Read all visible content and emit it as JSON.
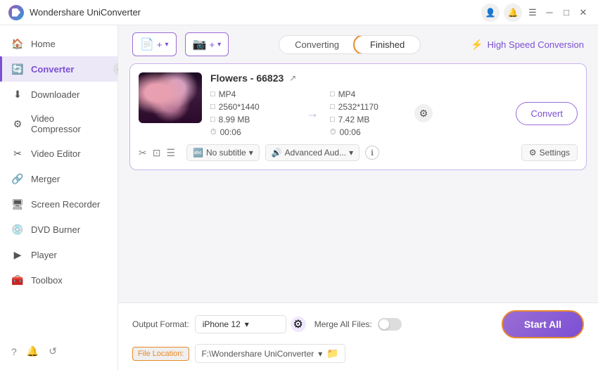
{
  "app": {
    "title": "Wondershare UniConverter"
  },
  "titlebar": {
    "icons": [
      "user-icon",
      "bell-icon",
      "menu-icon",
      "minimize-icon",
      "maximize-icon",
      "close-icon"
    ]
  },
  "sidebar": {
    "items": [
      {
        "id": "home",
        "label": "Home",
        "icon": "🏠"
      },
      {
        "id": "converter",
        "label": "Converter",
        "icon": "🔄",
        "active": true
      },
      {
        "id": "downloader",
        "label": "Downloader",
        "icon": "⬇️"
      },
      {
        "id": "video-compressor",
        "label": "Video Compressor",
        "icon": "🗜️"
      },
      {
        "id": "video-editor",
        "label": "Video Editor",
        "icon": "✂️"
      },
      {
        "id": "merger",
        "label": "Merger",
        "icon": "🔗"
      },
      {
        "id": "screen-recorder",
        "label": "Screen Recorder",
        "icon": "🖥️"
      },
      {
        "id": "dvd-burner",
        "label": "DVD Burner",
        "icon": "💿"
      },
      {
        "id": "player",
        "label": "Player",
        "icon": "▶️"
      },
      {
        "id": "toolbox",
        "label": "Toolbox",
        "icon": "🧰"
      }
    ],
    "bottom_icons": [
      "question-icon",
      "bell-icon",
      "refresh-icon"
    ]
  },
  "toolbar": {
    "add_button_label": "+",
    "camera_button_label": "+",
    "tab_converting": "Converting",
    "tab_finished": "Finished",
    "high_speed_label": "High Speed Conversion"
  },
  "file_card": {
    "name": "Flowers - 66823",
    "source": {
      "format": "MP4",
      "resolution": "2560*1440",
      "size": "8.99 MB",
      "duration": "00:06"
    },
    "target": {
      "format": "MP4",
      "resolution": "2532*1170",
      "size": "7.42 MB",
      "duration": "00:06"
    },
    "subtitle": "No subtitle",
    "audio": "Advanced Aud...",
    "convert_btn_label": "Convert",
    "settings_btn_label": "Settings"
  },
  "bottom_bar": {
    "output_format_label": "Output Format:",
    "output_format_value": "iPhone 12",
    "merge_files_label": "Merge All Files:",
    "file_location_label": "File Location:",
    "file_path": "F:\\Wondershare UniConverter",
    "start_all_label": "Start All"
  }
}
